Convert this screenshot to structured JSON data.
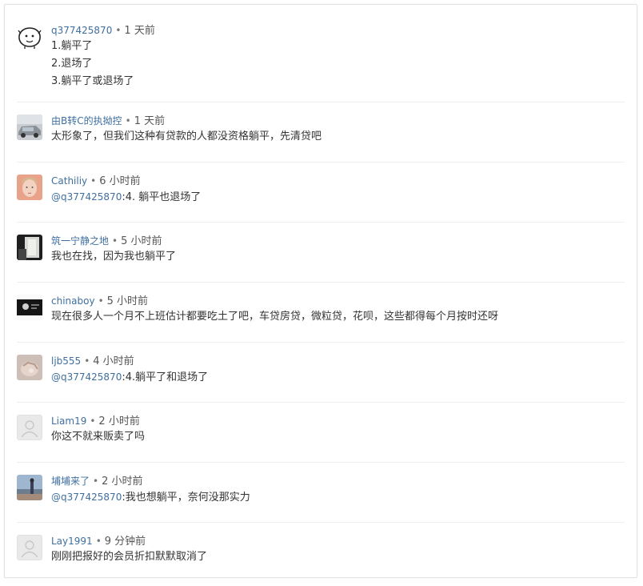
{
  "comments": [
    {
      "author": "q377425870",
      "time": "1 天前",
      "lines": [
        "1.躺平了",
        "2.退场了",
        "3.躺平了或退场了"
      ],
      "avatar_icon": "cartoon-face-icon"
    },
    {
      "author": "由B转C的执拗控",
      "time": "1 天前",
      "text": "太形象了，但我们这种有贷款的人都没资格躺平，先清贷吧",
      "avatar_icon": "car-photo-avatar"
    },
    {
      "author": "Cathiliy",
      "time": "6 小时前",
      "mention": "@q377425870",
      "text": ":4. 躺平也退场了",
      "avatar_icon": "portrait-photo-avatar"
    },
    {
      "author": "筑一宁静之地",
      "time": "5 小时前",
      "text": "我也在找，因为我也躺平了",
      "avatar_icon": "dark-photo-avatar"
    },
    {
      "author": "chinaboy",
      "time": "5 小时前",
      "text": "现在很多人一个月不上班估计都要吃土了吧，车贷房贷，微粒贷，花呗，这些都得每个月按时还呀",
      "avatar_icon": "screen-photo-avatar"
    },
    {
      "author": "ljb555",
      "time": "4 小时前",
      "mention": "@q377425870",
      "text": ":4.躺平了和退场了",
      "avatar_icon": "hand-photo-avatar"
    },
    {
      "author": "Liam19",
      "time": "2 小时前",
      "text": "你这不就来贩卖了吗",
      "avatar_icon": "default-user-icon"
    },
    {
      "author": "埔埔来了",
      "time": "2 小时前",
      "mention": "@q377425870",
      "text": ":我也想躺平，奈何没那实力",
      "avatar_icon": "beach-photo-avatar"
    },
    {
      "author": "Lay1991",
      "time": "9 分钟前",
      "text": "刚刚把报好的会员折扣默默取消了",
      "avatar_icon": "default-user-icon"
    }
  ],
  "separator": "•"
}
